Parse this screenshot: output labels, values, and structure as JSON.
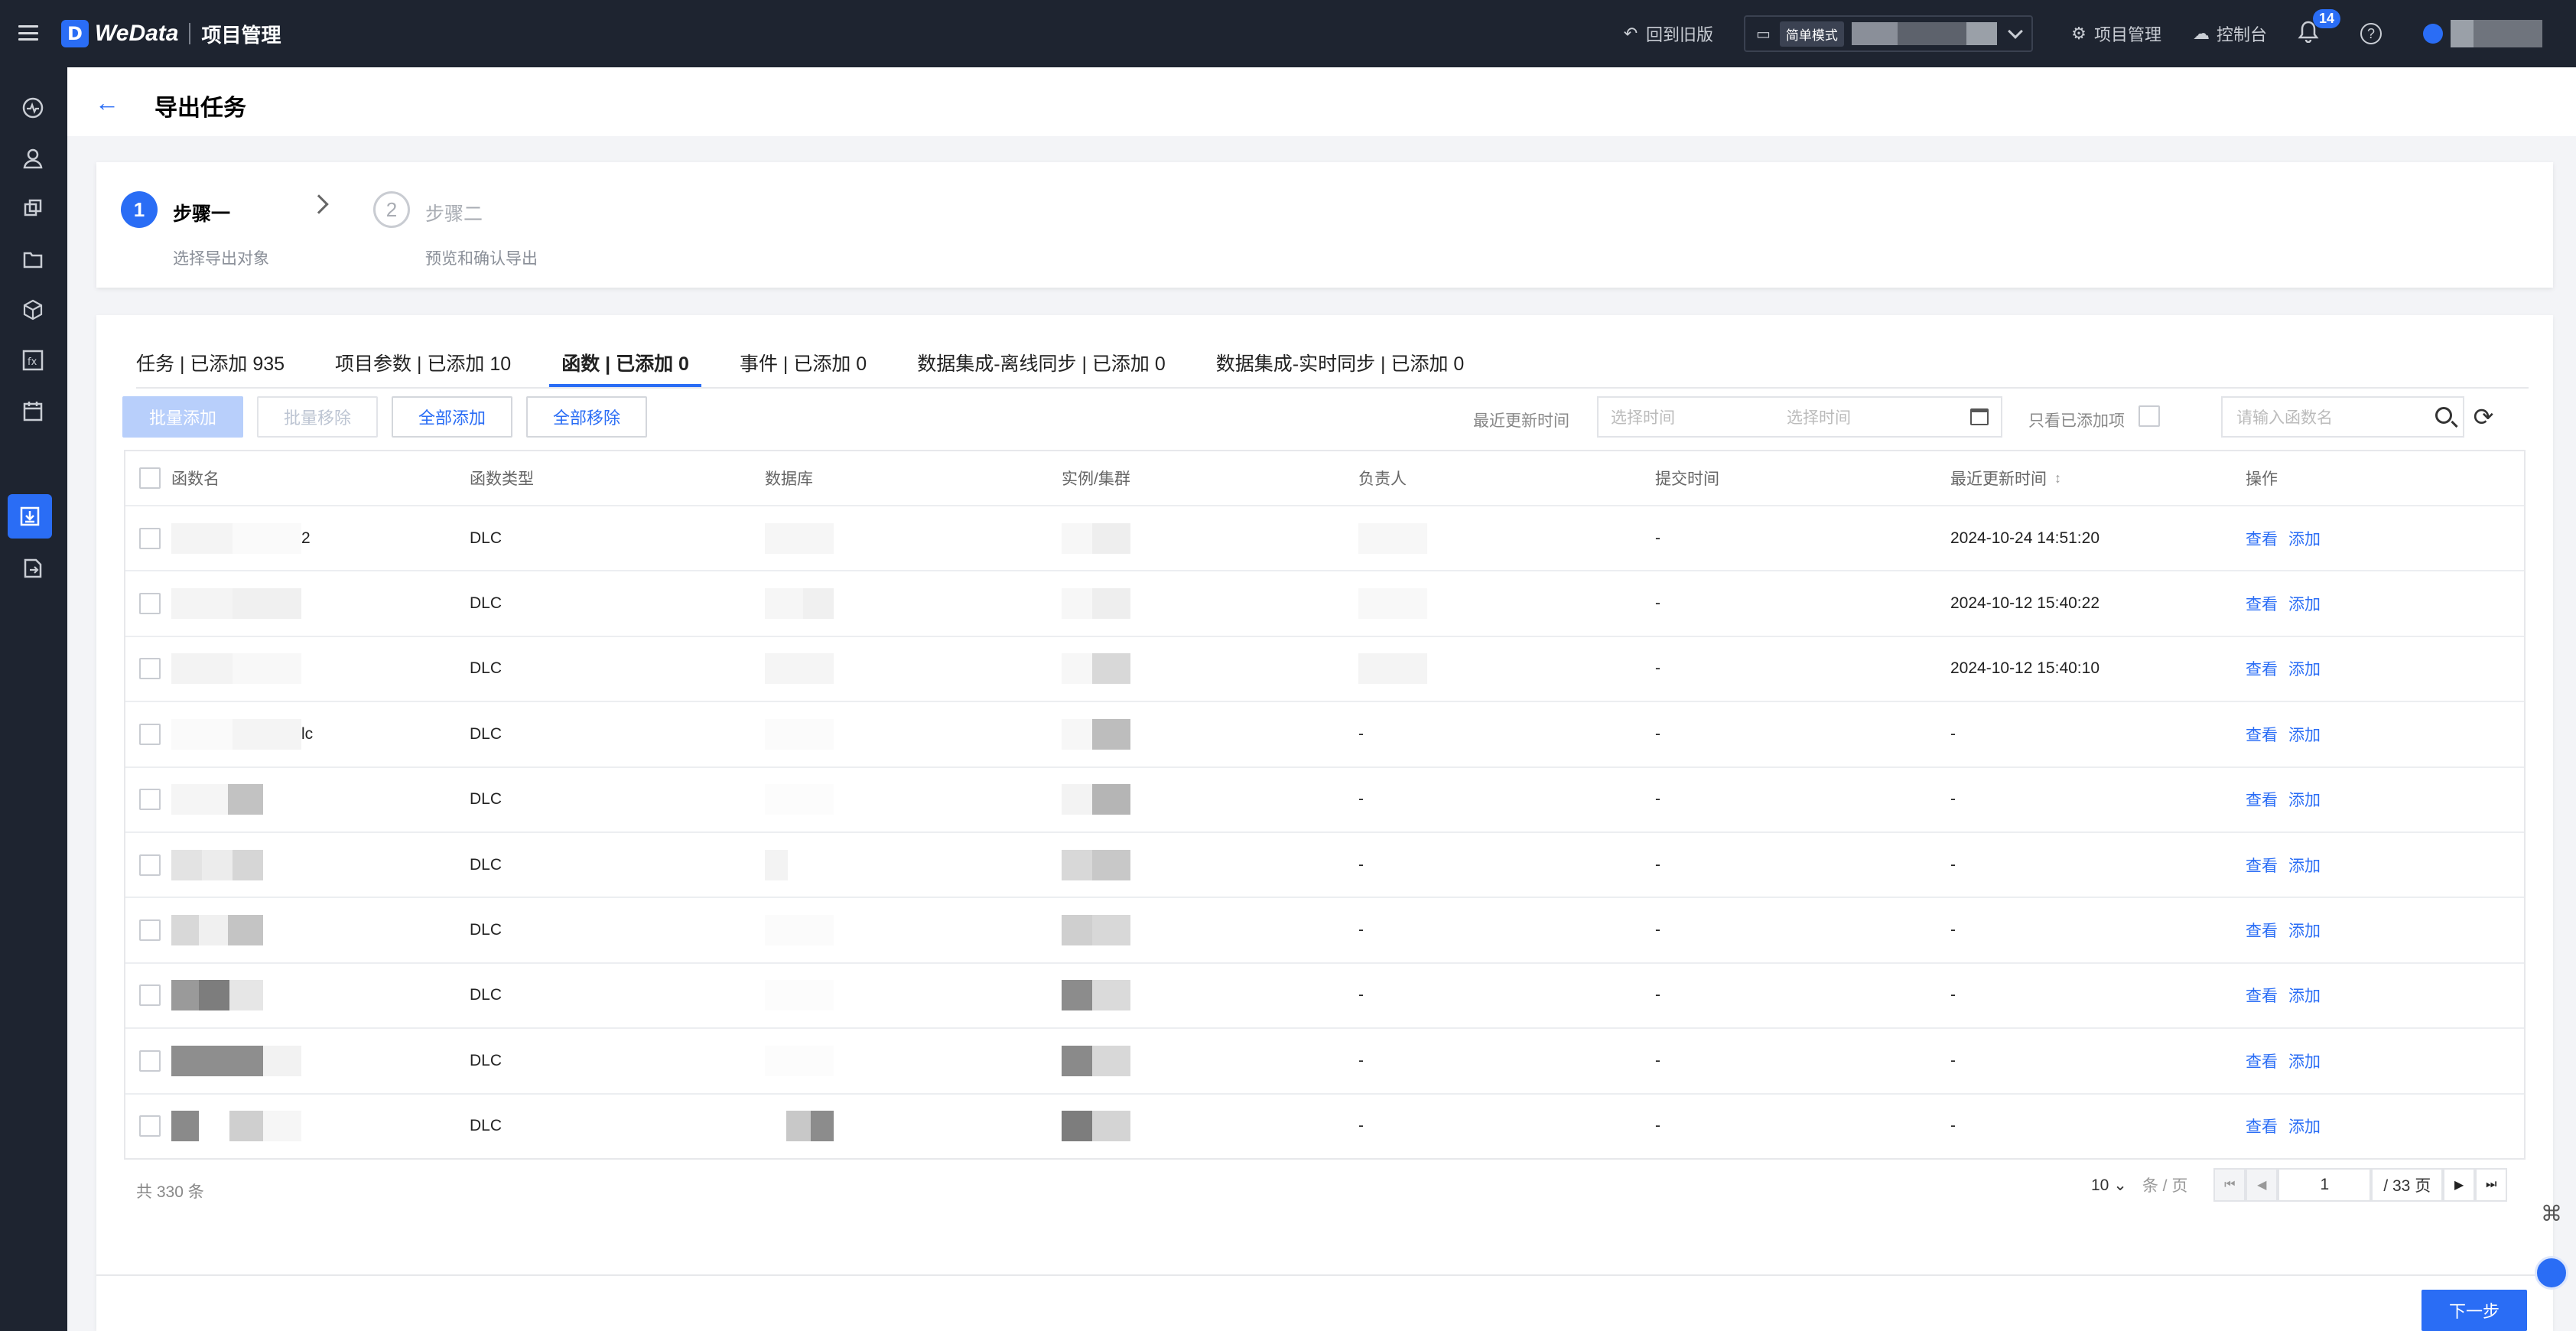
{
  "app": {
    "brand": "WeData",
    "brand_mark": "D",
    "section": "项目管理",
    "back_old": "回到旧版",
    "mode_tag": "简单模式",
    "project_mgmt": "项目管理",
    "console": "控制台",
    "notif_count": "14"
  },
  "page": {
    "title": "导出任务"
  },
  "steps": [
    {
      "num": "1",
      "title": "步骤一",
      "desc": "选择导出对象"
    },
    {
      "num": "2",
      "title": "步骤二",
      "desc": "预览和确认导出"
    }
  ],
  "tabs": [
    {
      "label": "任务 | 已添加 935"
    },
    {
      "label": "项目参数 | 已添加 10"
    },
    {
      "label": "函数 | 已添加 0"
    },
    {
      "label": "事件 | 已添加 0"
    },
    {
      "label": "数据集成-离线同步 | 已添加 0"
    },
    {
      "label": "数据集成-实时同步 | 已添加 0"
    }
  ],
  "toolbar": {
    "batch_add": "批量添加",
    "batch_remove": "批量移除",
    "add_all": "全部添加",
    "remove_all": "全部移除",
    "updated_label": "最近更新时间",
    "start_placeholder": "选择时间",
    "end_placeholder": "选择时间",
    "only_added": "只看已添加项",
    "search_placeholder": "请输入函数名"
  },
  "table": {
    "columns": [
      "函数名",
      "函数类型",
      "数据库",
      "实例/集群",
      "负责人",
      "提交时间",
      "最近更新时间",
      "操作"
    ],
    "rows": [
      {
        "name_suffix": "2",
        "type": "DLC",
        "owner": "",
        "submit": "-",
        "updated": "2024-10-24 14:51:20",
        "view": "查看",
        "add": "添加"
      },
      {
        "name_suffix": "",
        "type": "DLC",
        "owner": "",
        "submit": "-",
        "updated": "2024-10-12 15:40:22",
        "view": "查看",
        "add": "添加"
      },
      {
        "name_suffix": "",
        "type": "DLC",
        "owner": "",
        "submit": "-",
        "updated": "2024-10-12 15:40:10",
        "view": "查看",
        "add": "添加"
      },
      {
        "name_suffix": "lc",
        "type": "DLC",
        "owner": "-",
        "submit": "-",
        "updated": "-",
        "view": "查看",
        "add": "添加"
      },
      {
        "name_suffix": "",
        "type": "DLC",
        "owner": "-",
        "submit": "-",
        "updated": "-",
        "view": "查看",
        "add": "添加"
      },
      {
        "name_suffix": "",
        "type": "DLC",
        "owner": "-",
        "submit": "-",
        "updated": "-",
        "view": "查看",
        "add": "添加"
      },
      {
        "name_suffix": "",
        "type": "DLC",
        "owner": "-",
        "submit": "-",
        "updated": "-",
        "view": "查看",
        "add": "添加"
      },
      {
        "name_suffix": "",
        "type": "DLC",
        "owner": "-",
        "submit": "-",
        "updated": "-",
        "view": "查看",
        "add": "添加"
      },
      {
        "name_suffix": "",
        "type": "DLC",
        "owner": "-",
        "submit": "-",
        "updated": "-",
        "view": "查看",
        "add": "添加"
      },
      {
        "name_suffix": "",
        "type": "DLC",
        "owner": "-",
        "submit": "-",
        "updated": "-",
        "view": "查看",
        "add": "添加"
      }
    ]
  },
  "pagination": {
    "total": "共 330 条",
    "page_size": "10",
    "page_size_unit": "条 / 页",
    "current": "1",
    "total_pages": "/ 33 页"
  },
  "footer": {
    "next": "下一步"
  },
  "colors": {
    "accent": "#2a6df5",
    "topbar": "#1e2430"
  }
}
